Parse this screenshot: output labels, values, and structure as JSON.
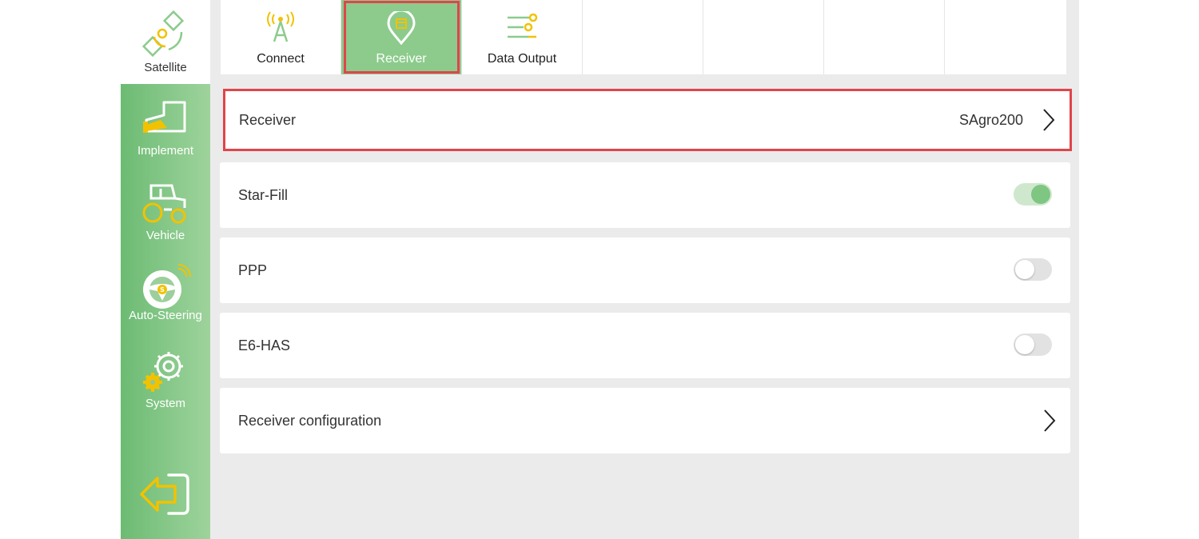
{
  "colors": {
    "accent_green": "#8ccb8c",
    "icon_yellow": "#f2c200",
    "highlight_red": "#e0454b"
  },
  "sidebar": {
    "items": [
      {
        "label": "Satellite",
        "icon": "satellite-icon",
        "active": true
      },
      {
        "label": "Implement",
        "icon": "implement-icon",
        "active": false
      },
      {
        "label": "Vehicle",
        "icon": "tractor-icon",
        "active": false
      },
      {
        "label": "Auto-Steering",
        "icon": "steering-wheel-icon",
        "active": false
      },
      {
        "label": "System",
        "icon": "gear-icon",
        "active": false
      }
    ],
    "exit_icon": "exit-icon"
  },
  "tabs": [
    {
      "label": "Connect",
      "icon": "antenna-icon",
      "active": false
    },
    {
      "label": "Receiver",
      "icon": "location-pin-icon",
      "active": true
    },
    {
      "label": "Data Output",
      "icon": "data-output-icon",
      "active": false
    }
  ],
  "settings": {
    "receiver": {
      "label": "Receiver",
      "value": "SAgro200"
    },
    "star_fill": {
      "label": "Star-Fill",
      "enabled": true
    },
    "ppp": {
      "label": "PPP",
      "enabled": false
    },
    "e6_has": {
      "label": "E6-HAS",
      "enabled": false
    },
    "receiver_configuration": {
      "label": "Receiver configuration"
    }
  }
}
